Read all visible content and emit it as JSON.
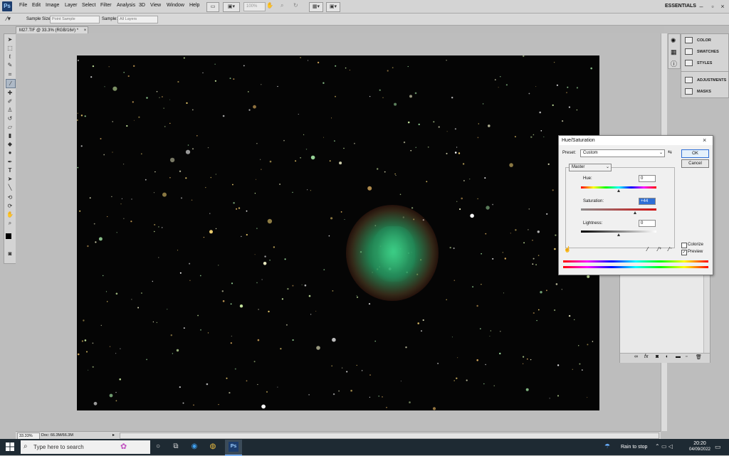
{
  "app": {
    "logo": "Ps",
    "workspace": "ESSENTIALS"
  },
  "menu": [
    "File",
    "Edit",
    "Image",
    "Layer",
    "Select",
    "Filter",
    "Analysis",
    "3D",
    "View",
    "Window",
    "Help"
  ],
  "menubar_zoom": "100%",
  "options": {
    "sample_size_label": "Sample Size:",
    "sample_size_value": "Point Sample",
    "sample_label": "Sample:",
    "sample_value": "All Layers"
  },
  "document": {
    "tab_title": "M27.TIF @ 33.3% (RGB/16#) *",
    "zoom": "33.33%",
    "doc_info": "Doc: 66.3M/66.3M"
  },
  "panels": [
    {
      "label": "COLOR",
      "icon": "color-icon"
    },
    {
      "label": "SWATCHES",
      "icon": "swatches-icon"
    },
    {
      "label": "STYLES",
      "icon": "styles-icon"
    },
    {
      "label": "ADJUSTMENTS",
      "icon": "adjustments-icon"
    },
    {
      "label": "MASKS",
      "icon": "masks-icon"
    }
  ],
  "dialog": {
    "title": "Hue/Saturation",
    "preset_label": "Preset:",
    "preset_value": "Custom",
    "ok": "OK",
    "cancel": "Cancel",
    "channel": "Master",
    "hue_label": "Hue:",
    "hue_value": "0",
    "hue_level": 0.5,
    "saturation_label": "Saturation:",
    "saturation_value": "+44",
    "saturation_level": 0.72,
    "lightness_label": "Lightness:",
    "lightness_value": "0",
    "lightness_level": 0.5,
    "colorize_label": "Colorize",
    "colorize_checked": false,
    "preview_label": "Preview",
    "preview_checked": true
  },
  "taskbar": {
    "search_placeholder": "Type here to search",
    "weather": "Rain to stop",
    "time": "20:20",
    "date": "04/09/2022"
  }
}
